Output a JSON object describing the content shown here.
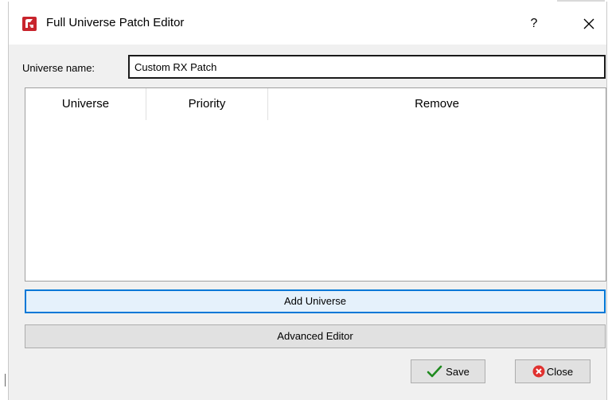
{
  "window": {
    "title": "Full Universe Patch Editor",
    "help_label": "?"
  },
  "form": {
    "name_label": "Universe name:",
    "name_value": "Custom RX Patch"
  },
  "table": {
    "columns": [
      "Universe",
      "Priority",
      "Remove"
    ],
    "rows": []
  },
  "actions": {
    "add_universe_label": "Add Universe",
    "advanced_editor_label": "Advanced Editor",
    "save_label": "Save",
    "close_label": "Close"
  },
  "icons": {
    "app": "app-logo-icon",
    "help": "help-icon",
    "close": "close-icon",
    "save": "checkmark-icon",
    "close_button": "red-x-circle-icon"
  },
  "colors": {
    "app_icon": "#c8242c",
    "focus_border": "#0078d7",
    "checkmark": "#1f8a1f",
    "close_icon": "#e0312f"
  }
}
